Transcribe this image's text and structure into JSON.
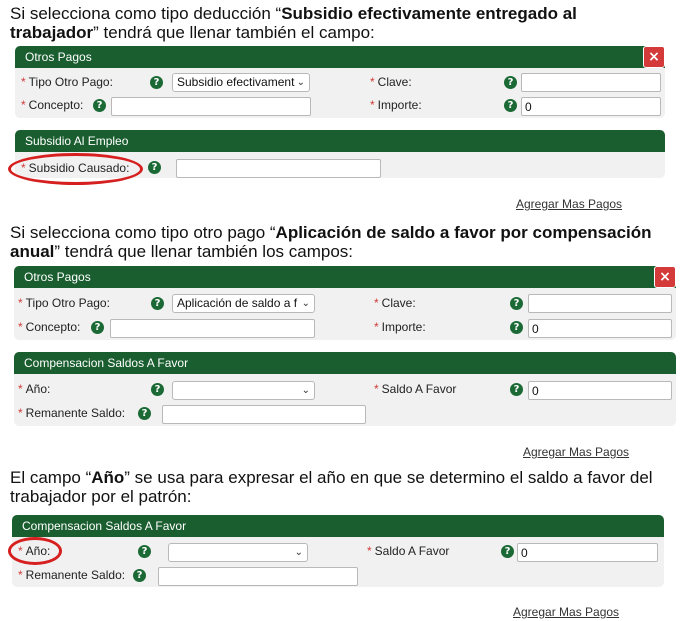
{
  "paragraph1": {
    "part1": "Si selecciona como tipo deducción “",
    "bold1": "Subsidio efectivamente entregado al trabajador",
    "part2": "” tendrá que llenar también el campo:"
  },
  "panel1": {
    "title": "Otros Pagos",
    "close_icon": "×",
    "tipo_label": "Tipo Otro Pago:",
    "tipo_value": "Subsidio efectivament",
    "clave_label": "Clave:",
    "clave_value": "",
    "concepto_label": "Concepto:",
    "concepto_value": "",
    "importe_label": "Importe:",
    "importe_value": "0"
  },
  "panel2": {
    "title": "Subsidio Al Empleo",
    "subsidio_label": "Subsidio Causado:",
    "subsidio_value": ""
  },
  "link1": "Agregar Mas Pagos",
  "paragraph2": {
    "part1": "Si selecciona como tipo otro pago “",
    "bold1": "Aplicación de saldo a favor por compensación anual",
    "part2": "” tendrá que llenar también los campos:"
  },
  "panel3": {
    "title": "Otros Pagos",
    "close_icon": "×",
    "tipo_label": "Tipo Otro Pago:",
    "tipo_value": "Aplicación de saldo a f",
    "clave_label": "Clave:",
    "clave_value": "",
    "concepto_label": "Concepto:",
    "concepto_value": "",
    "importe_label": "Importe:",
    "importe_value": "0"
  },
  "panel4": {
    "title": "Compensacion Saldos A Favor",
    "anio_label": "Año:",
    "anio_value": "",
    "saldo_label": "Saldo A Favor",
    "saldo_value": "0",
    "remanente_label": "Remanente Saldo:",
    "remanente_value": ""
  },
  "link2": "Agregar Mas Pagos",
  "paragraph3": {
    "part1": "El campo “",
    "bold1": "Año",
    "part2": "” se usa para expresar el año en que se determino el saldo a favor del trabajador por el patrón:"
  },
  "panel5": {
    "title": "Compensacion Saldos A Favor",
    "anio_label": "Año:",
    "anio_value": "",
    "saldo_label": "Saldo A Favor",
    "saldo_value": "0",
    "remanente_label": "Remanente Saldo:",
    "remanente_value": ""
  },
  "link3": "Agregar Mas Pagos",
  "icons": {
    "help": "?",
    "chevron": "⌄",
    "required": "*"
  },
  "colors": {
    "header": "#1a5e30",
    "close": "#d43a3a",
    "highlight": "#d61f1f",
    "panel_bg": "#f1f1f1"
  }
}
